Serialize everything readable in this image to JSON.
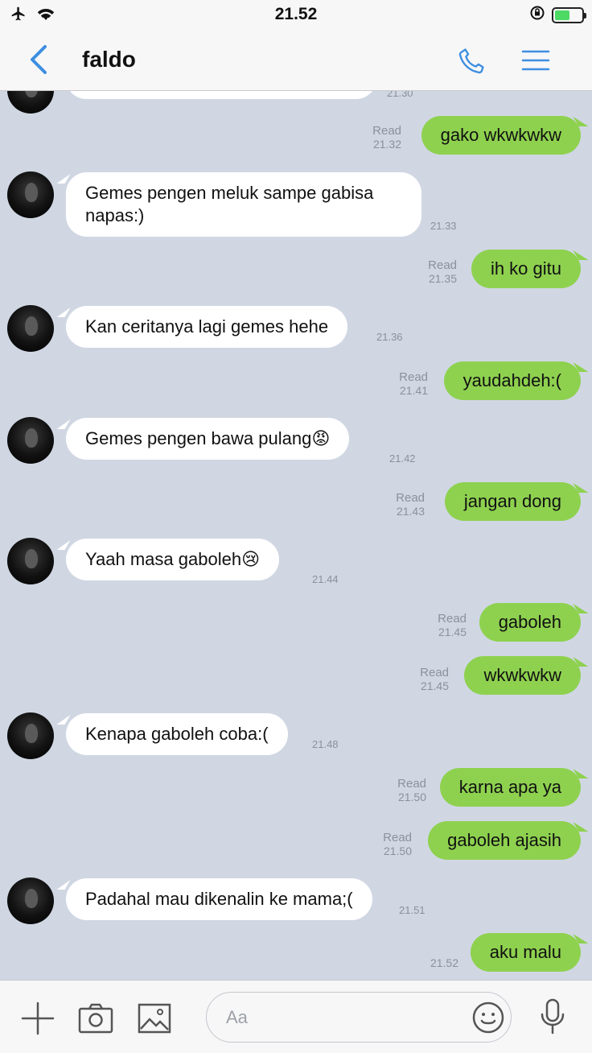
{
  "status_bar": {
    "time": "21.52"
  },
  "header": {
    "contact_name": "faldo"
  },
  "chat": {
    "partial_top_time": "21.30",
    "messages": [
      {
        "dir": "out",
        "text": "gako wkwkwkw",
        "read": "Read",
        "time": "21.32"
      },
      {
        "dir": "in",
        "text": "Gemes pengen meluk sampe gabisa napas:)",
        "time": "21.33"
      },
      {
        "dir": "out",
        "text": "ih ko gitu",
        "read": "Read",
        "time": "21.35"
      },
      {
        "dir": "in",
        "text": "Kan ceritanya lagi gemes hehe",
        "time": "21.36"
      },
      {
        "dir": "out",
        "text": "yaudahdeh:(",
        "read": "Read",
        "time": "21.41"
      },
      {
        "dir": "in",
        "text": "Gemes pengen bawa pulang😡",
        "time": "21.42"
      },
      {
        "dir": "out",
        "text": "jangan dong",
        "read": "Read",
        "time": "21.43"
      },
      {
        "dir": "in",
        "text": "Yaah masa gaboleh😢",
        "time": "21.44"
      },
      {
        "dir": "out",
        "text": "gaboleh",
        "read": "Read",
        "time": "21.45"
      },
      {
        "dir": "out",
        "text": "wkwkwkw",
        "read": "Read",
        "time": "21.45"
      },
      {
        "dir": "in",
        "text": "Kenapa gaboleh coba:(",
        "time": "21.48"
      },
      {
        "dir": "out",
        "text": "karna apa ya",
        "read": "Read",
        "time": "21.50"
      },
      {
        "dir": "out",
        "text": "gaboleh ajasih",
        "read": "Read",
        "time": "21.50"
      },
      {
        "dir": "in",
        "text": "Padahal mau dikenalin ke mama;(",
        "time": "21.51"
      },
      {
        "dir": "out",
        "text": "aku malu",
        "read": "",
        "time": "21.52"
      }
    ]
  },
  "composer": {
    "placeholder": "Aa"
  },
  "colors": {
    "accent": "#3d8ee0",
    "bubble_out": "#8ed14f",
    "bubble_in": "#ffffff",
    "chat_bg": "#d0d7e3"
  },
  "icons": [
    "airplane-icon",
    "wifi-icon",
    "orientation-lock-icon",
    "battery-icon",
    "back-chevron-icon",
    "phone-icon",
    "menu-icon",
    "plus-icon",
    "camera-icon",
    "image-icon",
    "emoji-icon",
    "microphone-icon"
  ]
}
